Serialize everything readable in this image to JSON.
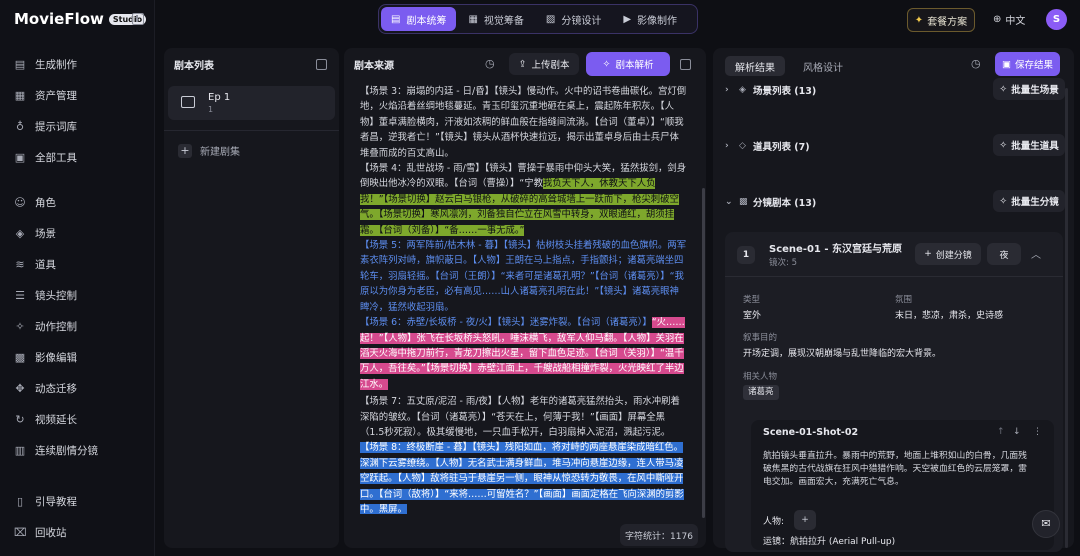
{
  "brand": {
    "name": "MovieFlow",
    "badge": "Studio"
  },
  "sidebar": {
    "group1": [
      {
        "label": "生成制作",
        "icon": "clapper-icon"
      },
      {
        "label": "资产管理",
        "icon": "grid-icon"
      },
      {
        "label": "提示词库",
        "icon": "bulb-icon"
      },
      {
        "label": "全部工具",
        "icon": "apps-icon"
      }
    ],
    "group2": [
      {
        "label": "角色",
        "icon": "user-icon"
      },
      {
        "label": "场景",
        "icon": "layers-icon"
      },
      {
        "label": "道具",
        "icon": "stack-icon"
      },
      {
        "label": "镜头控制",
        "icon": "sliders-icon"
      },
      {
        "label": "动作控制",
        "icon": "wand-icon"
      },
      {
        "label": "影像编辑",
        "icon": "film-icon"
      },
      {
        "label": "动态迁移",
        "icon": "move-icon"
      },
      {
        "label": "视频延长",
        "icon": "refresh-icon"
      },
      {
        "label": "连续剧情分镜",
        "icon": "board-icon"
      }
    ],
    "bottom": [
      {
        "label": "引导教程",
        "icon": "book-icon"
      },
      {
        "label": "回收站",
        "icon": "trash-icon"
      }
    ]
  },
  "topnav": {
    "tabs": [
      "剧本统筹",
      "视觉筹备",
      "分镜设计",
      "影像制作"
    ],
    "active": 0
  },
  "header": {
    "pricing": "套餐方案",
    "lang": "中文",
    "avatar": "S"
  },
  "scriptList": {
    "title": "剧本列表",
    "episode": {
      "title": "Ep 1",
      "sub": "1"
    },
    "new": "新建剧集"
  },
  "scriptSource": {
    "title": "剧本来源",
    "upload": "上传剧本",
    "parse": "剧本解析",
    "charCount": "字符统计：1176"
  },
  "script": {
    "p1": "【场景 3：崩塌的内廷 - 日/昏】【镜头】慢动作。火中的诏书卷曲碳化。宫灯倒地，火焰沿着丝绸地毯蔓延。青玉印玺沉重地砸在桌上，震起陈年积灰。【人物】董卓满脸横肉，汗液如浓稠的鲜血般在指缝间流淌。【台词（董卓）】“顺我者昌，逆我者亡！”【镜头】镜头从酒杯快速拉远，揭示出董卓身后由士兵尸体堆叠而成的百丈高山。",
    "p2a": "【场景 4：乱世战场 - 雨/雪】【镜头】曹操于暴雨中仰头大笑，猛然拔剑，剑身倒映出他冰冷的双眼。【台词（曹操）】“宁教",
    "p2b": "我负天下人，休教天下人负我！”【场景切换】赵云白马银枪，从破碎的高耸城墙上一跃而下，枪尖刺破空气。【场景切换】寒风凛冽，刘备独自伫立在风雪中转身，双眼通红，胡须挂霜。【台词（刘备）】“备……一事无成。”",
    "p3": "【场景 5：两军阵前/枯木林 - 暮】【镜头】枯树枝头挂着残破的血色旗帜。两军素衣阵列对峙，旗帜蔽日。【人物】王朗在马上指点，手指颤抖；诸葛亮端坐四轮车，羽扇轻摇。【台词（王朗）】“来者可是诸葛孔明？”【台词（诸葛亮）】“我原以为你身为老臣，必有高见……山人诸葛亮孔明在此！”【镜头】诸葛亮眼神睥冷，猛然收起羽扇。",
    "p4a": "【场景 6：赤壁/长坂桥 - 夜/火】【镜头】迷雾炸裂。【台词（诸葛亮）】",
    "p4b": "“火……起！”【人物】张飞在长坂桥头怒吼，唾沫横飞，敌军人仰马翻。【人物】关羽在滔天火海中拖刀前行，青龙刀擦出火星，留下血色足迹。【台词（关羽）】“温千万人，吾往矣。”【场景切换】赤壁江面上，千艘战船相撞炸裂，火光映红了半边江水。",
    "p5": "【场景 7：五丈原/泥沼 - 雨/夜】【人物】老年的诸葛亮猛然抬头，雨水冲刷着深陷的皱纹。【台词（诸葛亮）】“苍天在上，何薄于我！”【画面】屏幕全黑（1.5秒死寂）。极其缓慢地，一只血手松开，白羽扇掉入泥沼，溅起污泥。",
    "p6": "【场景 8：终极断崖 - 暮】【镜头】残阳如血，将对峙的两座悬崖染成暗红色。深渊下云雾缭绕。【人物】无名武士满身鲜血，堆马冲向悬崖边缘，连人带马凌空跃起。【人物】敌将驻马于悬崖另一侧，眼神从惊恐转为敬畏，在风中嘶哑开口。【台词（敌将）】“来将……可留姓名？”【画面】画面定格在飞向深渊的剪影中。黑屏。"
  },
  "analysis": {
    "tabs": [
      "解析结果",
      "风格设计"
    ],
    "save": "保存结果",
    "sections": [
      {
        "label": "场景列表 (13)",
        "button": "批量生场景"
      },
      {
        "label": "道具列表 (7)",
        "button": "批量生道具"
      },
      {
        "label": "分镜剧本 (13)",
        "button": "批量生分镜"
      }
    ],
    "scene": {
      "num": "1",
      "title": "Scene-01 - 东汉宫廷与荒原",
      "sub": "镜次: 5",
      "create": "创建分镜",
      "time": "夜",
      "typeLabel": "类型",
      "typeValue": "室外",
      "moodLabel": "氛围",
      "moodValue": "末日，悲凉，肃杀，史诗感",
      "purposeLabel": "叙事目的",
      "purposeValue": "开场定调，展现汉朝崩塌与乱世降临的宏大背景。",
      "peopleLabel": "相关人物",
      "person": "诸葛亮"
    },
    "shot": {
      "title": "Scene-01-Shot-02",
      "desc": "航拍镜头垂直拉升。暴雨中的荒野，地面上堆积如山的白骨，几面残破焦黑的古代战旗在狂风中猎猎作响。天空被血红色的云层笼罩，雷电交加。画面宏大，充满死亡气息。",
      "peopleLabel": "人物:",
      "motion": "运镜：航拍拉升 (Aerial Pull-up)"
    }
  }
}
